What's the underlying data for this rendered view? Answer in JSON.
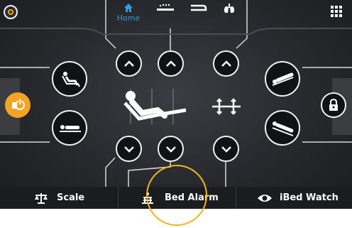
{
  "top_tabs": [
    {
      "name": "Home",
      "label": "Home",
      "icon": "home-icon",
      "active": true
    },
    {
      "name": "bed-positions",
      "label": "",
      "icon": "bed-positions-icon",
      "active": false
    },
    {
      "name": "bed-frame",
      "label": "",
      "icon": "bed-frame-icon",
      "active": false
    },
    {
      "name": "lungs",
      "label": "",
      "icon": "lungs-icon",
      "active": false
    }
  ],
  "bottom_bar": {
    "scale_label": "Scale",
    "bed_alarm_label": "Bed Alarm",
    "ibed_watch_label": "iBed Watch"
  },
  "colors": {
    "accent": "#2f9be0",
    "panel": "#25272b",
    "bottom_bar": "#1b1c1e",
    "highlight": "#f4b41a",
    "exit_alert": "#f4a322"
  },
  "icons": [
    "app-logo-icon",
    "grid-menu-icon",
    "chair-position-icon",
    "flat-position-icon",
    "trendelenburg-icon",
    "reverse-trendelenburg-icon",
    "chevron-up-icon",
    "chevron-down-icon",
    "bed-articulation-icon",
    "height-adjust-icon",
    "exit-alert-icon",
    "lock-icon",
    "scale-icon",
    "bed-alarm-icon",
    "eye-icon"
  ]
}
